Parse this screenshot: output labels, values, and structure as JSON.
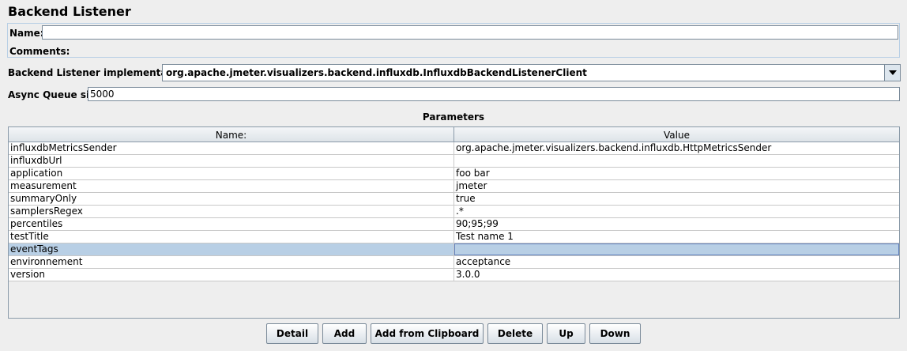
{
  "title": "Backend Listener",
  "name_field": {
    "label": "Name:",
    "value": ""
  },
  "comments": {
    "label": "Comments:"
  },
  "implementation": {
    "label": "Backend Listener implementation",
    "value": "org.apache.jmeter.visualizers.backend.influxdb.InfluxdbBackendListenerClient"
  },
  "queue": {
    "label": "Async Queue size",
    "value": "5000"
  },
  "parameters": {
    "title": "Parameters",
    "columns": [
      "Name:",
      "Value"
    ],
    "rows": [
      {
        "name": "influxdbMetricsSender",
        "value": "org.apache.jmeter.visualizers.backend.influxdb.HttpMetricsSender"
      },
      {
        "name": "influxdbUrl",
        "value": ""
      },
      {
        "name": "application",
        "value": "foo bar"
      },
      {
        "name": "measurement",
        "value": "jmeter"
      },
      {
        "name": "summaryOnly",
        "value": "true"
      },
      {
        "name": "samplersRegex",
        "value": ".*"
      },
      {
        "name": "percentiles",
        "value": "90;95;99"
      },
      {
        "name": "testTitle",
        "value": "Test name 1"
      },
      {
        "name": "eventTags",
        "value": "",
        "selected": true
      },
      {
        "name": "environnement",
        "value": "acceptance"
      },
      {
        "name": "version",
        "value": "3.0.0"
      }
    ]
  },
  "buttons": {
    "detail": "Detail",
    "add": "Add",
    "add_from_clipboard": "Add from Clipboard",
    "delete": "Delete",
    "up": "Up",
    "down": "Down"
  },
  "colors": {
    "background": "#eeeeee",
    "selection": "#b8cfe5",
    "border": "#7a8a99"
  },
  "icons": {
    "combo_arrow": "chevron-down-icon"
  }
}
